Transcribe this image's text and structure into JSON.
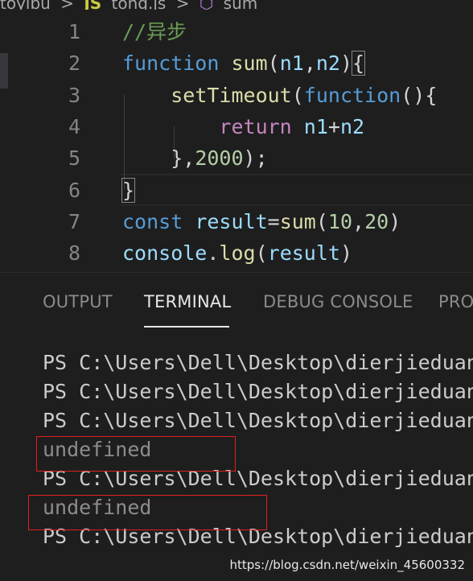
{
  "breadcrumb": {
    "folder": "toyibu",
    "sep1": ">",
    "file_icon": "JS",
    "file": "tong.js",
    "sep2": ">",
    "symbol_icon": "cube-icon",
    "symbol": "sum"
  },
  "editor": {
    "lines": [
      {
        "n": "1",
        "tokens": [
          [
            "cmt",
            "//异步"
          ]
        ]
      },
      {
        "n": "2",
        "tokens": [
          [
            "kw",
            "function"
          ],
          [
            "pun",
            " "
          ],
          [
            "fn",
            "sum"
          ],
          [
            "pun",
            "("
          ],
          [
            "var",
            "n1"
          ],
          [
            "pun",
            ","
          ],
          [
            "var",
            "n2"
          ],
          [
            "pun",
            ")"
          ],
          [
            "pun",
            "{"
          ]
        ]
      },
      {
        "n": "3",
        "tokens": [
          [
            "pun",
            "    "
          ],
          [
            "fn",
            "setTimeout"
          ],
          [
            "pun",
            "("
          ],
          [
            "kw",
            "function"
          ],
          [
            "pun",
            "(){"
          ]
        ]
      },
      {
        "n": "4",
        "tokens": [
          [
            "pun",
            "        "
          ],
          [
            "ctl",
            "return"
          ],
          [
            "pun",
            " "
          ],
          [
            "var",
            "n1"
          ],
          [
            "pun",
            "+"
          ],
          [
            "var",
            "n2"
          ]
        ]
      },
      {
        "n": "5",
        "tokens": [
          [
            "pun",
            "    },"
          ],
          [
            "num",
            "2000"
          ],
          [
            "pun",
            ");"
          ]
        ]
      },
      {
        "n": "6",
        "tokens": [
          [
            "pun",
            "}"
          ]
        ]
      },
      {
        "n": "7",
        "tokens": [
          [
            "kw",
            "const"
          ],
          [
            "pun",
            " "
          ],
          [
            "var",
            "result"
          ],
          [
            "pun",
            "="
          ],
          [
            "fn",
            "sum"
          ],
          [
            "pun",
            "("
          ],
          [
            "num",
            "10"
          ],
          [
            "pun",
            ","
          ],
          [
            "num",
            "20"
          ],
          [
            "pun",
            ")"
          ]
        ]
      },
      {
        "n": "8",
        "tokens": [
          [
            "var",
            "console"
          ],
          [
            "pun",
            "."
          ],
          [
            "fn",
            "log"
          ],
          [
            "pun",
            "("
          ],
          [
            "var",
            "result"
          ],
          [
            "pun",
            ")"
          ]
        ]
      }
    ]
  },
  "panel": {
    "tabs": [
      "OUTPUT",
      "TERMINAL",
      "DEBUG CONSOLE",
      "PRO"
    ],
    "active_tab": "TERMINAL",
    "terminal_lines": [
      "PS C:\\Users\\Dell\\Desktop\\dierjieduan",
      "PS C:\\Users\\Dell\\Desktop\\dierjieduan",
      "PS C:\\Users\\Dell\\Desktop\\dierjieduan",
      "undefined",
      "PS C:\\Users\\Dell\\Desktop\\dierjieduan",
      "undefined",
      "PS C:\\Users\\Dell\\Desktop\\dierjieduan"
    ]
  },
  "watermark": "https://blog.csdn.net/weixin_45600332"
}
